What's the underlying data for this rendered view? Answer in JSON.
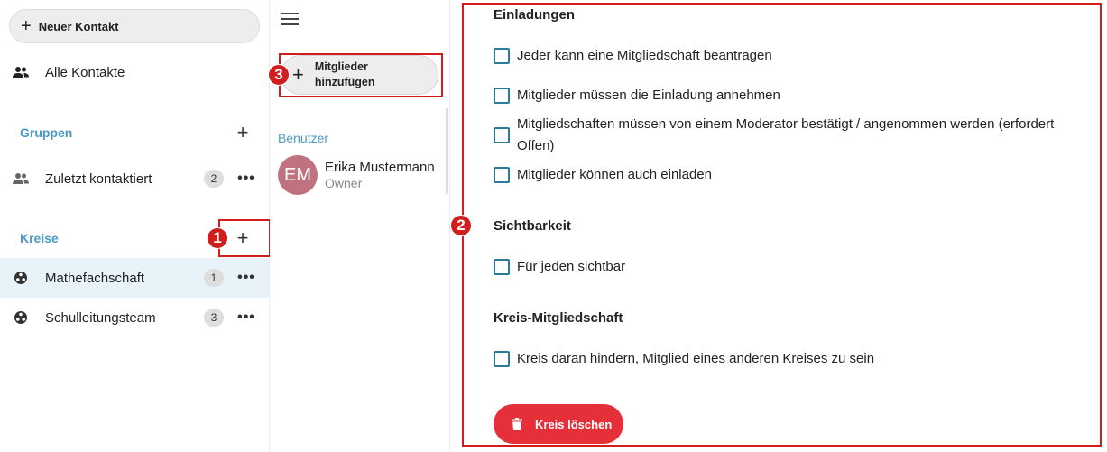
{
  "sidebar": {
    "new_contact_label": "Neuer Kontakt",
    "all_contacts_label": "Alle Kontakte",
    "groups_caption": "Gruppen",
    "groups": [
      {
        "label": "Zuletzt kontaktiert",
        "count": "2"
      }
    ],
    "circles_caption": "Kreise",
    "circles": [
      {
        "label": "Mathefachschaft",
        "count": "1",
        "active": true
      },
      {
        "label": "Schulleitungsteam",
        "count": "3",
        "active": false
      }
    ],
    "more_icon": "•••"
  },
  "middle": {
    "add_members_line1": "Mitglieder",
    "add_members_line2": "hinzufügen",
    "users_caption": "Benutzer",
    "member": {
      "initials": "EM",
      "name": "Erika Mustermann",
      "role": "Owner",
      "avatar_color": "#c0737e"
    }
  },
  "panel": {
    "invitations_heading": "Einladungen",
    "invitation_options": [
      "Jeder kann eine Mitgliedschaft beantragen",
      "Mitglieder müssen die Einladung annehmen",
      "Mitgliedschaften müssen von einem Moderator bestätigt / angenommen werden (erfordert Offen)",
      "Mitglieder können auch einladen"
    ],
    "visibility_heading": "Sichtbarkeit",
    "visibility_options": [
      "Für jeden sichtbar"
    ],
    "membership_heading": "Kreis-Mitgliedschaft",
    "membership_options": [
      "Kreis daran hindern, Mitglied eines anderen Kreises zu sein"
    ],
    "delete_label": "Kreis löschen"
  },
  "annotations": {
    "badge_1": "1",
    "badge_2": "2",
    "badge_3": "3",
    "color": "#d01d1d"
  },
  "colors": {
    "accent": "#4a9ac7",
    "checkbox_border": "#2b7ba0",
    "delete": "#e5303a",
    "active_row": "#e8f2f9"
  }
}
